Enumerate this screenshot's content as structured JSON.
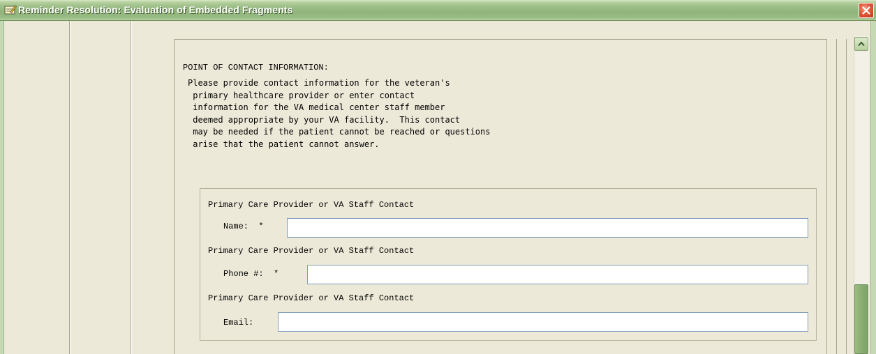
{
  "window": {
    "title": "Reminder Resolution: Evaluation of Embedded Fragments",
    "icon": "notepad-pencil-icon",
    "close_icon": "close-icon"
  },
  "section": {
    "title": "POINT OF CONTACT INFORMATION:",
    "description": "Please provide contact information for the veteran's\n primary healthcare provider or enter contact\n information for the VA medical center staff member\n deemed appropriate by your VA facility.  This contact\n may be needed if the patient cannot be reached or questions\n arise that the patient cannot answer."
  },
  "fields": [
    {
      "caption": "Primary Care Provider or VA Staff Contact",
      "label": "Name:  *",
      "value": ""
    },
    {
      "caption": "Primary Care Provider or VA Staff Contact",
      "label": "Phone #:  *",
      "value": ""
    },
    {
      "caption": "Primary Care Provider or VA Staff Contact",
      "label": "Email:",
      "value": ""
    }
  ],
  "scrollbar": {
    "up_icon": "scroll-up-arrow-icon"
  },
  "colors": {
    "title_bar": "#9fc08a",
    "close_button": "#e0583a",
    "panel_bg": "#ece9d8",
    "input_border": "#7f9db9"
  }
}
